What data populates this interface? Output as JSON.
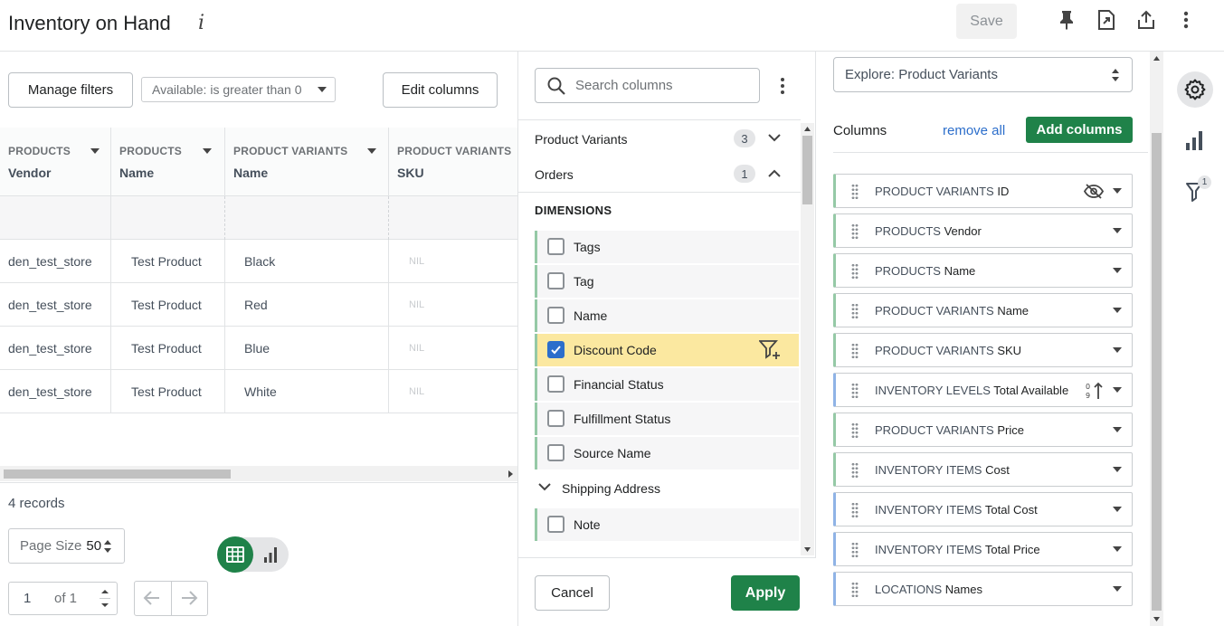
{
  "header": {
    "title": "Inventory on Hand",
    "info_glyph": "i",
    "save_label": "Save"
  },
  "toolbar_left": {
    "manage_filters": "Manage filters",
    "filter_value": "Available: is greater than 0",
    "edit_columns": "Edit columns"
  },
  "table": {
    "columns": [
      {
        "category": "PRODUCTS",
        "field": "Vendor"
      },
      {
        "category": "PRODUCTS",
        "field": "Name"
      },
      {
        "category": "PRODUCT VARIANTS",
        "field": "Name"
      },
      {
        "category": "PRODUCT VARIANTS",
        "field": "SKU"
      }
    ],
    "rows": [
      [
        "den_test_store",
        "Test Product",
        "Black",
        "NIL"
      ],
      [
        "den_test_store",
        "Test Product",
        "Red",
        "NIL"
      ],
      [
        "den_test_store",
        "Test Product",
        "Blue",
        "NIL"
      ],
      [
        "den_test_store",
        "Test Product",
        "White",
        "NIL"
      ]
    ]
  },
  "footer": {
    "records": "4 records",
    "page_size_label": "Page Size",
    "page_size_value": "50",
    "page_number": "1",
    "page_of": "of 1"
  },
  "column_picker": {
    "search_placeholder": "Search columns",
    "groups": [
      {
        "label": "Product Variants",
        "count": "3"
      },
      {
        "label": "Orders",
        "count": "1"
      }
    ],
    "dimensions_label": "DIMENSIONS",
    "items": [
      {
        "label": "Tags",
        "checked": false
      },
      {
        "label": "Tag",
        "checked": false
      },
      {
        "label": "Name",
        "checked": false
      },
      {
        "label": "Discount Code",
        "checked": true
      },
      {
        "label": "Financial Status",
        "checked": false
      },
      {
        "label": "Fulfillment Status",
        "checked": false
      },
      {
        "label": "Source Name",
        "checked": false
      }
    ],
    "subgroup": "Shipping Address",
    "note_label": "Note",
    "cancel": "Cancel",
    "apply": "Apply"
  },
  "settings": {
    "explore_label": "Explore: Product Variants",
    "columns_title": "Columns",
    "remove_all": "remove all",
    "add_columns": "Add columns",
    "columns": [
      {
        "category": "PRODUCT VARIANTS",
        "field": "ID"
      },
      {
        "category": "PRODUCTS",
        "field": "Vendor"
      },
      {
        "category": "PRODUCTS",
        "field": "Name"
      },
      {
        "category": "PRODUCT VARIANTS",
        "field": "Name"
      },
      {
        "category": "PRODUCT VARIANTS",
        "field": "SKU"
      },
      {
        "category": "INVENTORY LEVELS",
        "field": "Total Available"
      },
      {
        "category": "PRODUCT VARIANTS",
        "field": "Price"
      },
      {
        "category": "INVENTORY ITEMS",
        "field": "Cost"
      },
      {
        "category": "INVENTORY ITEMS",
        "field": "Total Cost"
      },
      {
        "category": "INVENTORY ITEMS",
        "field": "Total Price"
      },
      {
        "category": "LOCATIONS",
        "field": "Names"
      }
    ]
  },
  "rail": {
    "filter_badge": "1"
  },
  "colors": {
    "primary_green": "#1f8249",
    "link_blue": "#2c6ecb",
    "highlight_yellow": "#fbe8a0",
    "dimension_green": "#95c9a6",
    "measure_blue": "#8fb3e6"
  }
}
